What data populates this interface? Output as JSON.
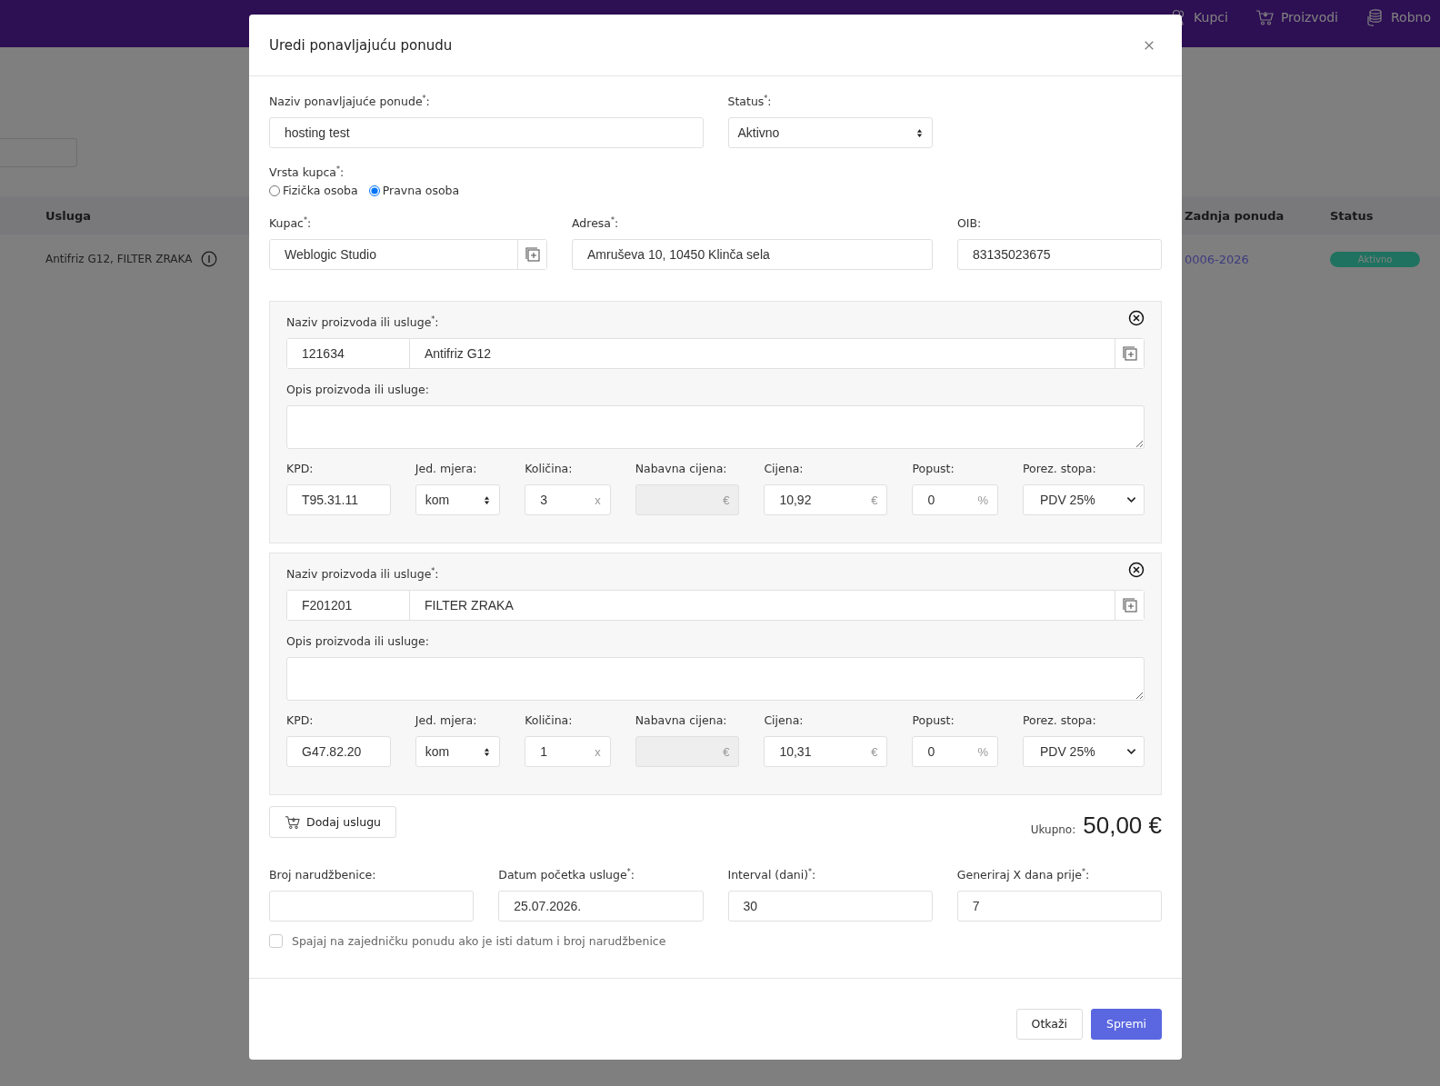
{
  "nav": [
    {
      "label": "Kupci",
      "kind": "person"
    },
    {
      "label": "Proizvodi",
      "kind": "cart"
    },
    {
      "label": "Robno",
      "kind": "coins"
    }
  ],
  "background": {
    "table": {
      "columns": [
        "Usluga",
        "Zadnja ponuda",
        "Status"
      ],
      "rows": [
        {
          "service": "Antifriz G12, FILTER ZRAKA",
          "last_offer": "0006-2026",
          "status": "Aktivno"
        }
      ]
    }
  },
  "modal": {
    "title": "Uredi ponavljajuću ponudu",
    "name": {
      "label": "Naziv ponavljajuće ponude$^{*}$:",
      "value": "hosting test"
    },
    "status": {
      "label": "Status$^{*}$:",
      "value": "Aktivno"
    },
    "customer_type": {
      "label": "Vrsta kupca$^{*}$:",
      "options": [
        {
          "label": "Fizička osoba",
          "selected": false
        },
        {
          "label": "Pravna osoba",
          "selected": true
        }
      ]
    },
    "customer": {
      "label": "Kupac$^{*}$:",
      "value": "Weblogic Studio"
    },
    "address": {
      "label": "Adresa$^{*}$:",
      "value": "Amruševa 10, 10450 Klinča sela"
    },
    "oib": {
      "label": "OIB:",
      "value": "83135023675"
    },
    "items": [
      {
        "name_label": "Naziv proizvoda ili usluge$^{*}$:",
        "code": "121634",
        "name": "Antifriz G12",
        "description_label": "Opis proizvoda ili usluge:",
        "fields": [
          {
            "label": "KPD:",
            "kind": "text",
            "value": "T95.31.11"
          },
          {
            "label": "Jed. mjera:",
            "kind": "spinner",
            "value": "kom"
          },
          {
            "label": "Količina:",
            "kind": "suffix",
            "value": "3",
            "suffix": "x",
            "disabled": false
          },
          {
            "label": "Nabavna cijena:",
            "kind": "suffix",
            "suffix": "€",
            "disabled": true
          },
          {
            "label": "Cijena:",
            "kind": "suffix",
            "value": "10,92",
            "suffix": "€",
            "disabled": false
          },
          {
            "label": "Popust:",
            "kind": "suffix",
            "value": "0",
            "suffix": "%",
            "disabled": false
          },
          {
            "label": "Porez. stopa:",
            "kind": "dropdown",
            "value": "PDV 25%"
          }
        ]
      },
      {
        "name_label": "Naziv proizvoda ili usluge$^{*}$:",
        "code": "F201201",
        "name": "FILTER ZRAKA",
        "description_label": "Opis proizvoda ili usluge:",
        "fields": [
          {
            "label": "KPD:",
            "kind": "text",
            "value": "G47.82.20"
          },
          {
            "label": "Jed. mjera:",
            "kind": "spinner",
            "value": "kom"
          },
          {
            "label": "Količina:",
            "kind": "suffix",
            "value": "1",
            "suffix": "x",
            "disabled": false
          },
          {
            "label": "Nabavna cijena:",
            "kind": "suffix",
            "suffix": "€",
            "disabled": true
          },
          {
            "label": "Cijena:",
            "kind": "suffix",
            "value": "10,31",
            "suffix": "€",
            "disabled": false
          },
          {
            "label": "Popust:",
            "kind": "suffix",
            "value": "0",
            "suffix": "%",
            "disabled": false
          },
          {
            "label": "Porez. stopa:",
            "kind": "dropdown",
            "value": "PDV 25%"
          }
        ]
      }
    ],
    "add_button": "Dodaj uslugu",
    "total_label": "Ukupno:",
    "total": "50,00 €",
    "bottom_fields": [
      {
        "label": "Broj narudžbenice:"
      },
      {
        "label": "Datum početka usluge$^{*}$:",
        "value": "25.07.2026."
      },
      {
        "label": "Interval (dani)$^{*}$:",
        "value": "30"
      },
      {
        "label": "Generiraj X dana prije$^{*}$:",
        "value": "7"
      }
    ],
    "merge_checkbox": {
      "label": "Spajaj na zajedničku ponudu ako je isti datum i broj narudžbenice",
      "checked": false
    },
    "buttons": [
      {
        "label": "Otkaži",
        "kind": "secondary"
      },
      {
        "label": "Spremi",
        "kind": "primary"
      }
    ]
  }
}
